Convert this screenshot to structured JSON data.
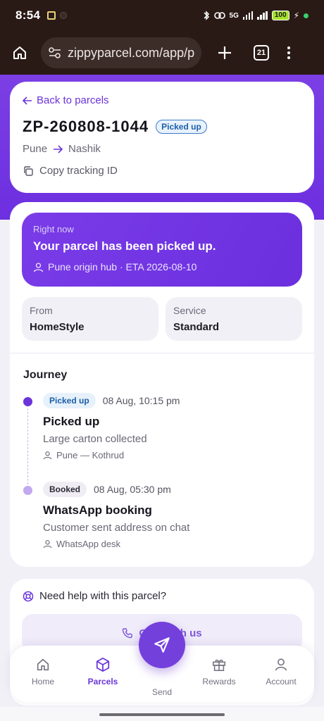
{
  "status_bar": {
    "time": "8:54",
    "network": "5G",
    "battery": "100"
  },
  "browser": {
    "url": "zippyparcel.com/app/p",
    "tab_count": "21"
  },
  "parcel": {
    "back_label": "Back to parcels",
    "id": "ZP-260808-1044",
    "status_badge": "Picked up",
    "origin": "Pune",
    "destination": "Nashik",
    "copy_label": "Copy tracking ID"
  },
  "status_card": {
    "kicker": "Right now",
    "message": "Your parcel has been picked up.",
    "location": "Pune origin hub · ETA 2026-08-10"
  },
  "info": {
    "from_label": "From",
    "from_value": "HomeStyle",
    "service_label": "Service",
    "service_value": "Standard"
  },
  "journey": {
    "title": "Journey",
    "events": [
      {
        "tag": "Picked up",
        "time": "08 Aug, 10:15 pm",
        "title": "Picked up",
        "desc": "Large carton collected",
        "location": "Pune — Kothrud"
      },
      {
        "tag": "Booked",
        "time": "08 Aug, 05:30 pm",
        "title": "WhatsApp booking",
        "desc": "Customer sent address on chat",
        "location": "WhatsApp desk"
      }
    ]
  },
  "help": {
    "title": "Need help with this parcel?",
    "button_label": "Chat with us"
  },
  "nav": {
    "items": [
      {
        "label": "Home",
        "icon": "home-icon"
      },
      {
        "label": "Parcels",
        "icon": "box-icon"
      },
      {
        "label": "Send",
        "icon": "send-icon"
      },
      {
        "label": "Rewards",
        "icon": "gift-icon"
      },
      {
        "label": "Account",
        "icon": "person-icon"
      }
    ],
    "active": "Parcels"
  },
  "colors": {
    "accent": "#6b34d9",
    "hero": "#7b3fe4",
    "badge_blue": "#1d5fa8"
  }
}
